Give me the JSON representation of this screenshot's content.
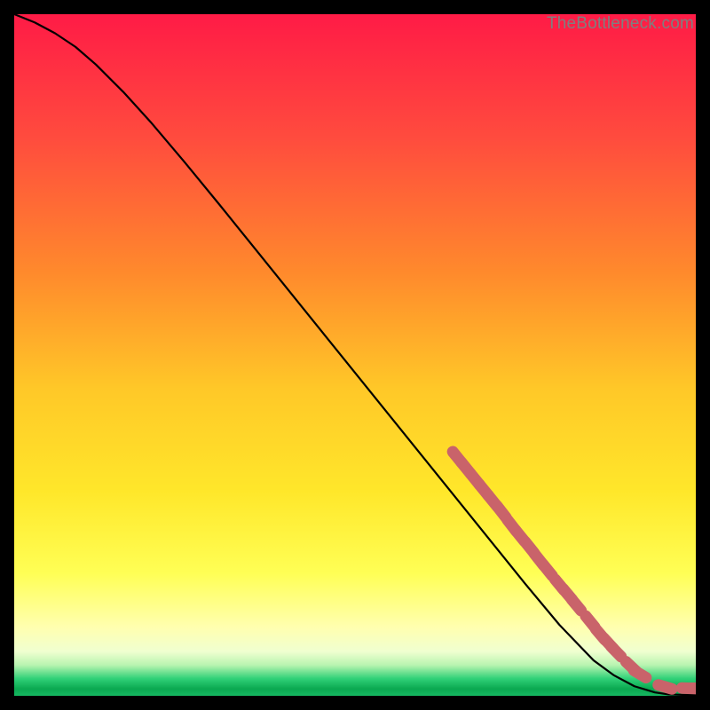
{
  "watermark": "TheBottleneck.com",
  "colors": {
    "gradient_top": "#ff1b46",
    "gradient_mid1": "#ff8a2c",
    "gradient_mid2": "#ffe72a",
    "gradient_mid3": "#ffff8a",
    "gradient_low": "#f4ffd8",
    "gradient_green": "#18c464",
    "curve": "#000000",
    "marker": "#c9636a"
  },
  "chart_data": {
    "type": "line",
    "title": "",
    "xlabel": "",
    "ylabel": "",
    "xlim": [
      0,
      100
    ],
    "ylim": [
      0,
      100
    ],
    "grid": false,
    "legend": false,
    "series": [
      {
        "name": "curve",
        "x": [
          0,
          3,
          6,
          9,
          12,
          16,
          20,
          25,
          30,
          35,
          40,
          45,
          50,
          55,
          60,
          65,
          70,
          75,
          80,
          85,
          88,
          91,
          94,
          96,
          98,
          100
        ],
        "y": [
          100,
          98.8,
          97.2,
          95.2,
          92.6,
          88.6,
          84.2,
          78.3,
          72.2,
          66.0,
          59.8,
          53.6,
          47.4,
          41.2,
          35.0,
          28.8,
          22.6,
          16.4,
          10.4,
          5.2,
          3.0,
          1.4,
          0.5,
          0.2,
          0.15,
          0.15
        ]
      }
    ],
    "markers": [
      {
        "x": 65.0,
        "y": 35.0
      },
      {
        "x": 66.3,
        "y": 33.4
      },
      {
        "x": 67.6,
        "y": 31.8
      },
      {
        "x": 68.9,
        "y": 30.2
      },
      {
        "x": 70.2,
        "y": 28.6
      },
      {
        "x": 71.5,
        "y": 27.0
      },
      {
        "x": 73.0,
        "y": 25.0
      },
      {
        "x": 74.2,
        "y": 23.5
      },
      {
        "x": 75.6,
        "y": 21.8
      },
      {
        "x": 77.0,
        "y": 20.0
      },
      {
        "x": 78.3,
        "y": 18.4
      },
      {
        "x": 80.0,
        "y": 16.3
      },
      {
        "x": 81.2,
        "y": 14.9
      },
      {
        "x": 82.5,
        "y": 13.3
      },
      {
        "x": 84.5,
        "y": 10.9
      },
      {
        "x": 86.0,
        "y": 9.0
      },
      {
        "x": 87.2,
        "y": 7.7
      },
      {
        "x": 88.3,
        "y": 6.5
      },
      {
        "x": 90.5,
        "y": 4.3
      },
      {
        "x": 91.8,
        "y": 3.2
      },
      {
        "x": 95.5,
        "y": 1.3
      },
      {
        "x": 99.0,
        "y": 1.1
      },
      {
        "x": 100.0,
        "y": 1.1
      }
    ]
  }
}
